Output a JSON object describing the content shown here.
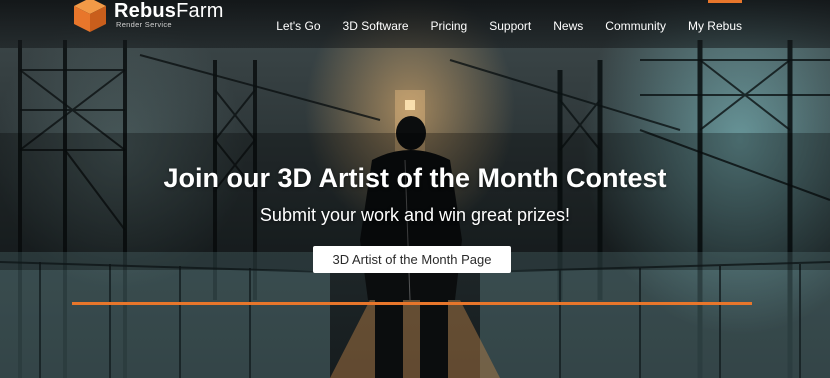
{
  "brand": {
    "name_bold": "Rebus",
    "name_light": "Farm",
    "tagline": "Render Service",
    "accent_color": "#e8762b"
  },
  "nav": {
    "items": [
      {
        "label": "Let's Go"
      },
      {
        "label": "3D Software"
      },
      {
        "label": "Pricing"
      },
      {
        "label": "Support"
      },
      {
        "label": "News"
      },
      {
        "label": "Community"
      },
      {
        "label": "My Rebus"
      }
    ]
  },
  "hero": {
    "title": "Join our 3D Artist of the Month Contest",
    "subtitle": "Submit your work and win great prizes!",
    "button_label": "3D Artist of the Month Page"
  }
}
